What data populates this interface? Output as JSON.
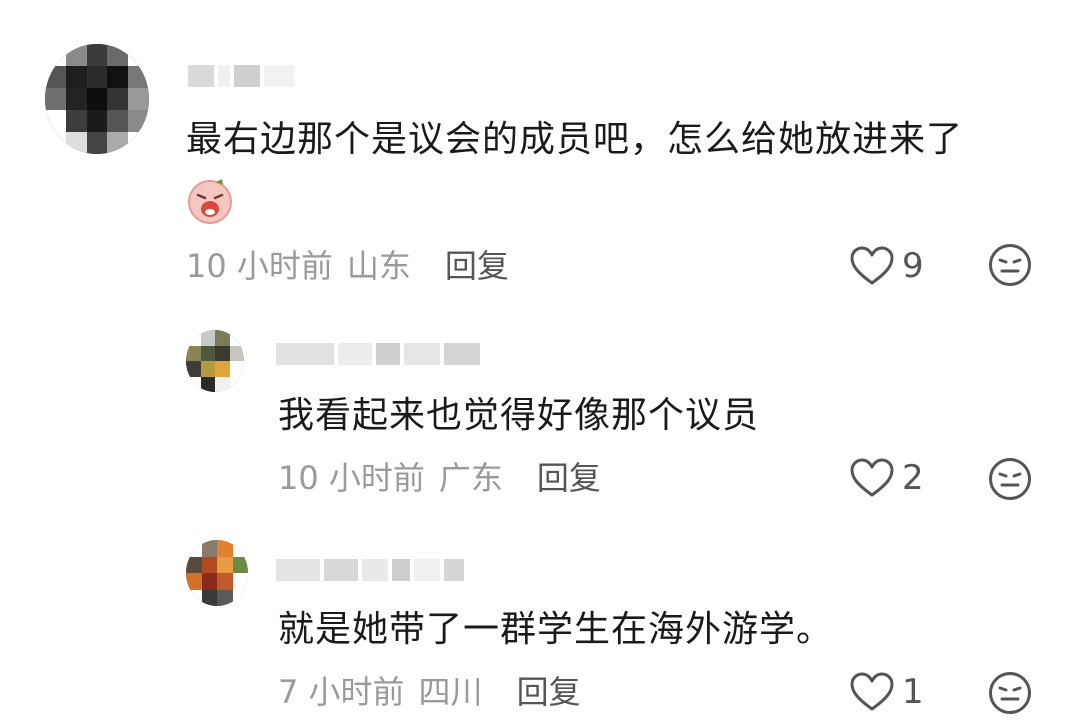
{
  "comments": [
    {
      "text": "最右边那个是议会的成员吧，怎么给她放进来了",
      "time": "10 小时前",
      "location": "山东",
      "reply_label": "回复",
      "likes": "9"
    },
    {
      "text": "我看起来也觉得好像那个议员",
      "time": "10 小时前",
      "location": "广东",
      "reply_label": "回复",
      "likes": "2"
    },
    {
      "text": "就是她带了一群学生在海外游学。",
      "time": "7 小时前",
      "location": "四川",
      "reply_label": "回复",
      "likes": "1"
    }
  ],
  "icons": {
    "like": "heart-outline-icon",
    "dislike": "meh-face-icon",
    "sticker": "crying-face-sticker"
  },
  "colors": {
    "text": "#1a1a1a",
    "meta": "#9a9a9a",
    "reply": "#555555"
  }
}
